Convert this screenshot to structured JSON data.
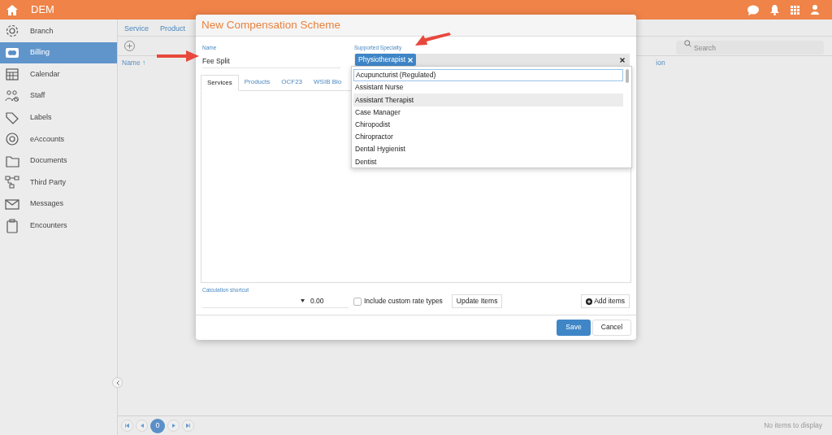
{
  "app_bar": {
    "title": "DEM"
  },
  "sidebar": {
    "items": [
      {
        "label": "Branch",
        "selected": false
      },
      {
        "label": "Billing",
        "selected": true
      },
      {
        "label": "Calendar",
        "selected": false
      },
      {
        "label": "Staff",
        "selected": false
      },
      {
        "label": "Labels",
        "selected": false
      },
      {
        "label": "eAccounts",
        "selected": false
      },
      {
        "label": "Documents",
        "selected": false
      },
      {
        "label": "Third Party",
        "selected": false
      },
      {
        "label": "Messages",
        "selected": false
      },
      {
        "label": "Encounters",
        "selected": false
      }
    ]
  },
  "background_tabs": [
    "Service",
    "Product"
  ],
  "background_table": {
    "columns": [
      "Name ↑",
      "ion"
    ],
    "search": {
      "placeholder": "Search"
    },
    "pager": {
      "page": "0",
      "status": "No items to display"
    }
  },
  "dialog": {
    "title": "New Compensation Scheme",
    "name": {
      "label": "Name",
      "value": "Fee Split"
    },
    "specialty": {
      "label": "Supported Specialty",
      "tags": [
        "Physiotherapist"
      ],
      "options": [
        {
          "label": "Acupuncturist (Regulated)",
          "focused": true,
          "hovered": false
        },
        {
          "label": "Assistant Nurse",
          "focused": false,
          "hovered": false
        },
        {
          "label": "Assistant Therapist",
          "focused": false,
          "hovered": true
        },
        {
          "label": "Case Manager",
          "focused": false,
          "hovered": false
        },
        {
          "label": "Chiropodist",
          "focused": false,
          "hovered": false
        },
        {
          "label": "Chiropractor",
          "focused": false,
          "hovered": false
        },
        {
          "label": "Dental Hygienist",
          "focused": false,
          "hovered": false
        },
        {
          "label": "Dentist",
          "focused": false,
          "hovered": false
        }
      ]
    },
    "tabs": [
      {
        "label": "Services",
        "selected": true
      },
      {
        "label": "Products",
        "selected": false
      },
      {
        "label": "OCF23",
        "selected": false
      },
      {
        "label": "WSIB Blo",
        "selected": false
      }
    ],
    "shortcut": {
      "label": "Calculation shortcut",
      "amount": "0.00"
    },
    "include_custom": {
      "label": "Include custom rate types",
      "checked": false
    },
    "update_button": "Update Items",
    "add_button": "Add items",
    "buttons": [
      "Save",
      "Cancel"
    ]
  }
}
